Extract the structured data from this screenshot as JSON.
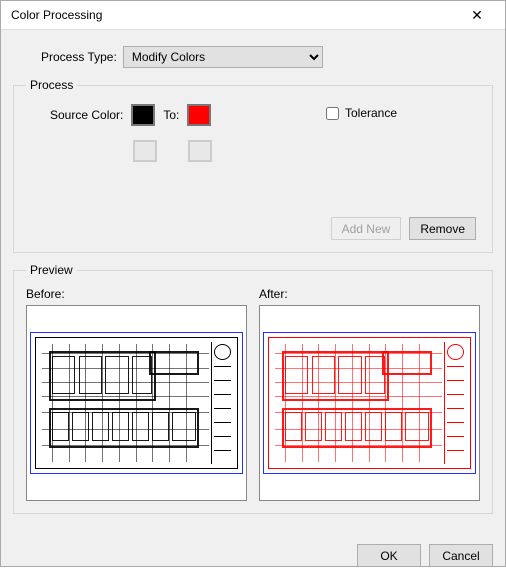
{
  "window": {
    "title": "Color Processing"
  },
  "processType": {
    "label": "Process Type:",
    "selected": "Modify Colors",
    "options": [
      "Modify Colors"
    ]
  },
  "process": {
    "legend": "Process",
    "sourceLabel": "Source Color:",
    "toLabel": "To:",
    "sourceColor": "#000000",
    "targetColor": "#ff0000",
    "toleranceLabel": "Tolerance",
    "toleranceChecked": false,
    "addNewLabel": "Add New",
    "removeLabel": "Remove"
  },
  "preview": {
    "legend": "Preview",
    "beforeLabel": "Before:",
    "afterLabel": "After:"
  },
  "footer": {
    "okLabel": "OK",
    "cancelLabel": "Cancel"
  }
}
